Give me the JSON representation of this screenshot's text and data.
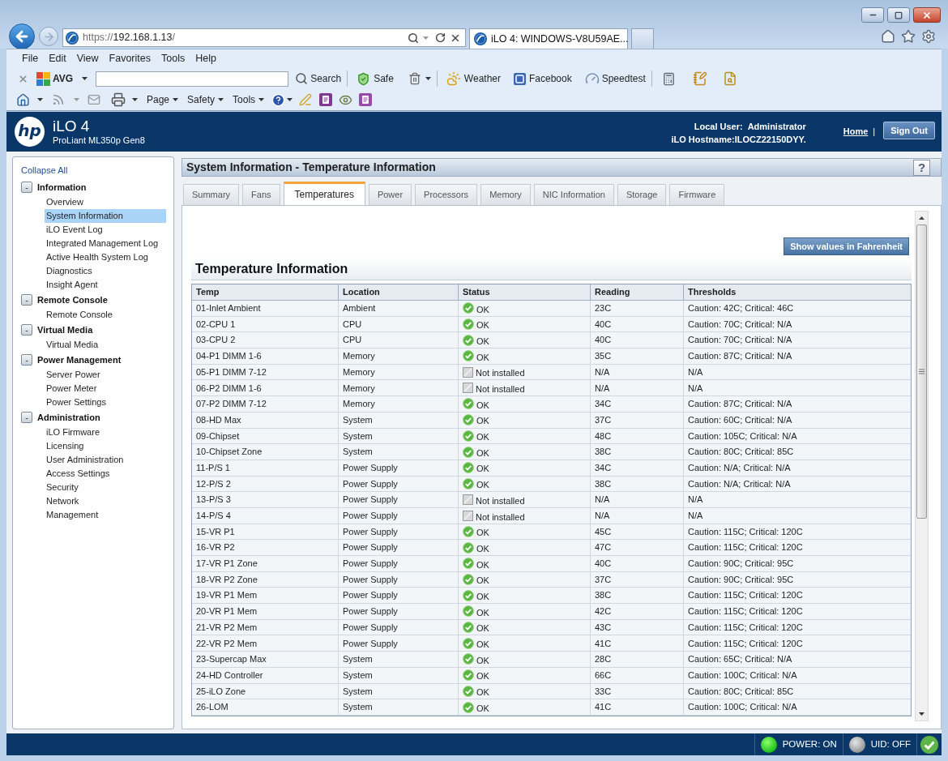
{
  "browser": {
    "address": {
      "scheme": "https://",
      "host": "192.168.1.13",
      "path": "/"
    },
    "tabs": [
      {
        "title": "iLO 4: WINDOWS-V8U59AE...",
        "selected": true
      }
    ],
    "menu": [
      "File",
      "Edit",
      "View",
      "Favorites",
      "Tools",
      "Help"
    ],
    "avg_toolbar": [
      {
        "kind": "close"
      },
      {
        "kind": "brand",
        "label": "AVG"
      },
      {
        "kind": "field"
      },
      {
        "kind": "search",
        "label": "Search"
      },
      {
        "kind": "separator"
      },
      {
        "kind": "shield",
        "label": "Safe"
      },
      {
        "kind": "trash"
      },
      {
        "kind": "separator"
      },
      {
        "kind": "weather",
        "label": "Weather"
      },
      {
        "kind": "facebook",
        "label": "Facebook"
      },
      {
        "kind": "speedtest",
        "label": "Speedtest"
      },
      {
        "kind": "separator"
      },
      {
        "kind": "calculator"
      },
      {
        "kind": "notepad"
      },
      {
        "kind": "finder"
      }
    ],
    "command_bar": [
      {
        "kind": "home"
      },
      {
        "kind": "feeds"
      },
      {
        "kind": "mail"
      },
      {
        "kind": "print"
      },
      {
        "kind": "menu",
        "label": "Page"
      },
      {
        "kind": "menu",
        "label": "Safety"
      },
      {
        "kind": "menu",
        "label": "Tools"
      },
      {
        "kind": "help"
      },
      {
        "kind": "research"
      },
      {
        "kind": "onenote"
      },
      {
        "kind": "eye"
      },
      {
        "kind": "onenote_link"
      }
    ]
  },
  "ilo_header": {
    "logo": "hp",
    "product": "iLO 4",
    "model": "ProLiant ML350p Gen8",
    "user_label": "Local User:",
    "user": "Administrator",
    "hostname": "iLO Hostname:ILOCZ22150DYY.",
    "home_link": "Home",
    "divider": "|",
    "sign_out": "Sign Out"
  },
  "sidebar": {
    "collapse_all": "Collapse All",
    "groups": [
      {
        "label": "Information",
        "toggle": "-",
        "expanded": true,
        "items": [
          {
            "label": "Overview",
            "selected": false
          },
          {
            "label": "System Information",
            "selected": true
          },
          {
            "label": "iLO Event Log",
            "selected": false
          },
          {
            "label": "Integrated Management Log",
            "selected": false
          },
          {
            "label": "Active Health System Log",
            "selected": false
          },
          {
            "label": "Diagnostics",
            "selected": false
          },
          {
            "label": "Insight Agent",
            "selected": false
          }
        ]
      },
      {
        "label": "Remote Console",
        "toggle": "-",
        "expanded": true,
        "items": [
          {
            "label": "Remote Console",
            "selected": false
          }
        ]
      },
      {
        "label": "Virtual Media",
        "toggle": "-",
        "expanded": true,
        "items": [
          {
            "label": "Virtual Media",
            "selected": false
          }
        ]
      },
      {
        "label": "Power Management",
        "toggle": "-",
        "expanded": true,
        "items": [
          {
            "label": "Server Power",
            "selected": false
          },
          {
            "label": "Power Meter",
            "selected": false
          },
          {
            "label": "Power Settings",
            "selected": false
          }
        ]
      },
      {
        "label": "Administration",
        "toggle": "-",
        "expanded": true,
        "items": [
          {
            "label": "iLO Firmware",
            "selected": false
          },
          {
            "label": "Licensing",
            "selected": false
          },
          {
            "label": "User Administration",
            "selected": false
          },
          {
            "label": "Access Settings",
            "selected": false
          },
          {
            "label": "Security",
            "selected": false
          },
          {
            "label": "Network",
            "selected": false
          },
          {
            "label": "Management",
            "selected": false
          }
        ]
      }
    ]
  },
  "page": {
    "title": "System Information - Temperature Information",
    "help": "?",
    "tabs": [
      {
        "label": "Summary",
        "selected": false
      },
      {
        "label": "Fans",
        "selected": false
      },
      {
        "label": "Temperatures",
        "selected": true
      },
      {
        "label": "Power",
        "selected": false
      },
      {
        "label": "Processors",
        "selected": false
      },
      {
        "label": "Memory",
        "selected": false
      },
      {
        "label": "NIC Information",
        "selected": false
      },
      {
        "label": "Storage",
        "selected": false
      },
      {
        "label": "Firmware",
        "selected": false
      }
    ],
    "fahrenheit_button": "Show values in Fahrenheit",
    "section_title": "Temperature Information",
    "table": {
      "columns": [
        "Temp",
        "Location",
        "Status",
        "Reading",
        "Thresholds"
      ],
      "rows": [
        {
          "temp": "01-Inlet Ambient",
          "location": "Ambient",
          "status": {
            "kind": "ok",
            "label": "OK"
          },
          "reading": "23C",
          "thresholds": "Caution: 42C; Critical: 46C"
        },
        {
          "temp": "02-CPU 1",
          "location": "CPU",
          "status": {
            "kind": "ok",
            "label": "OK"
          },
          "reading": "40C",
          "thresholds": "Caution: 70C; Critical: N/A"
        },
        {
          "temp": "03-CPU 2",
          "location": "CPU",
          "status": {
            "kind": "ok",
            "label": "OK"
          },
          "reading": "40C",
          "thresholds": "Caution: 70C; Critical: N/A"
        },
        {
          "temp": "04-P1 DIMM 1-6",
          "location": "Memory",
          "status": {
            "kind": "ok",
            "label": "OK"
          },
          "reading": "35C",
          "thresholds": "Caution: 87C; Critical: N/A"
        },
        {
          "temp": "05-P1 DIMM 7-12",
          "location": "Memory",
          "status": {
            "kind": "not_installed",
            "label": "Not installed"
          },
          "reading": "N/A",
          "thresholds": "N/A"
        },
        {
          "temp": "06-P2 DIMM 1-6",
          "location": "Memory",
          "status": {
            "kind": "not_installed",
            "label": "Not installed"
          },
          "reading": "N/A",
          "thresholds": "N/A"
        },
        {
          "temp": "07-P2 DIMM 7-12",
          "location": "Memory",
          "status": {
            "kind": "ok",
            "label": "OK"
          },
          "reading": "34C",
          "thresholds": "Caution: 87C; Critical: N/A"
        },
        {
          "temp": "08-HD Max",
          "location": "System",
          "status": {
            "kind": "ok",
            "label": "OK"
          },
          "reading": "37C",
          "thresholds": "Caution: 60C; Critical: N/A"
        },
        {
          "temp": "09-Chipset",
          "location": "System",
          "status": {
            "kind": "ok",
            "label": "OK"
          },
          "reading": "48C",
          "thresholds": "Caution: 105C; Critical: N/A"
        },
        {
          "temp": "10-Chipset Zone",
          "location": "System",
          "status": {
            "kind": "ok",
            "label": "OK"
          },
          "reading": "38C",
          "thresholds": "Caution: 80C; Critical: 85C"
        },
        {
          "temp": "11-P/S 1",
          "location": "Power Supply",
          "status": {
            "kind": "ok",
            "label": "OK"
          },
          "reading": "34C",
          "thresholds": "Caution: N/A; Critical: N/A"
        },
        {
          "temp": "12-P/S 2",
          "location": "Power Supply",
          "status": {
            "kind": "ok",
            "label": "OK"
          },
          "reading": "38C",
          "thresholds": "Caution: N/A; Critical: N/A"
        },
        {
          "temp": "13-P/S 3",
          "location": "Power Supply",
          "status": {
            "kind": "not_installed",
            "label": "Not installed"
          },
          "reading": "N/A",
          "thresholds": "N/A"
        },
        {
          "temp": "14-P/S 4",
          "location": "Power Supply",
          "status": {
            "kind": "not_installed",
            "label": "Not installed"
          },
          "reading": "N/A",
          "thresholds": "N/A"
        },
        {
          "temp": "15-VR P1",
          "location": "Power Supply",
          "status": {
            "kind": "ok",
            "label": "OK"
          },
          "reading": "45C",
          "thresholds": "Caution: 115C; Critical: 120C"
        },
        {
          "temp": "16-VR P2",
          "location": "Power Supply",
          "status": {
            "kind": "ok",
            "label": "OK"
          },
          "reading": "47C",
          "thresholds": "Caution: 115C; Critical: 120C"
        },
        {
          "temp": "17-VR P1 Zone",
          "location": "Power Supply",
          "status": {
            "kind": "ok",
            "label": "OK"
          },
          "reading": "40C",
          "thresholds": "Caution: 90C; Critical: 95C"
        },
        {
          "temp": "18-VR P2 Zone",
          "location": "Power Supply",
          "status": {
            "kind": "ok",
            "label": "OK"
          },
          "reading": "37C",
          "thresholds": "Caution: 90C; Critical: 95C"
        },
        {
          "temp": "19-VR P1 Mem",
          "location": "Power Supply",
          "status": {
            "kind": "ok",
            "label": "OK"
          },
          "reading": "38C",
          "thresholds": "Caution: 115C; Critical: 120C"
        },
        {
          "temp": "20-VR P1 Mem",
          "location": "Power Supply",
          "status": {
            "kind": "ok",
            "label": "OK"
          },
          "reading": "42C",
          "thresholds": "Caution: 115C; Critical: 120C"
        },
        {
          "temp": "21-VR P2 Mem",
          "location": "Power Supply",
          "status": {
            "kind": "ok",
            "label": "OK"
          },
          "reading": "43C",
          "thresholds": "Caution: 115C; Critical: 120C"
        },
        {
          "temp": "22-VR P2 Mem",
          "location": "Power Supply",
          "status": {
            "kind": "ok",
            "label": "OK"
          },
          "reading": "41C",
          "thresholds": "Caution: 115C; Critical: 120C"
        },
        {
          "temp": "23-Supercap Max",
          "location": "System",
          "status": {
            "kind": "ok",
            "label": "OK"
          },
          "reading": "28C",
          "thresholds": "Caution: 65C; Critical: N/A"
        },
        {
          "temp": "24-HD Controller",
          "location": "System",
          "status": {
            "kind": "ok",
            "label": "OK"
          },
          "reading": "66C",
          "thresholds": "Caution: 100C; Critical: N/A"
        },
        {
          "temp": "25-iLO Zone",
          "location": "System",
          "status": {
            "kind": "ok",
            "label": "OK"
          },
          "reading": "33C",
          "thresholds": "Caution: 80C; Critical: 85C"
        },
        {
          "temp": "26-LOM",
          "location": "System",
          "status": {
            "kind": "ok",
            "label": "OK"
          },
          "reading": "41C",
          "thresholds": "Caution: 100C; Critical: N/A"
        }
      ]
    }
  },
  "footer": {
    "indicators": [
      {
        "label": "POWER: ON",
        "on": true
      },
      {
        "label": "UID: OFF",
        "on": false
      }
    ]
  }
}
